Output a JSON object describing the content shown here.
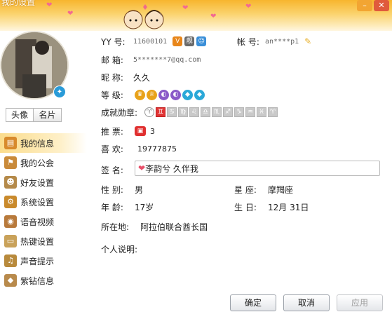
{
  "window": {
    "title": "我的设置"
  },
  "profile": {
    "tabs": [
      "头像",
      "名片"
    ]
  },
  "menu": [
    {
      "label": "我的信息",
      "icon": "id-card-icon",
      "color": "#d88a2c"
    },
    {
      "label": "我的公会",
      "icon": "flag-icon",
      "color": "#c98a3a"
    },
    {
      "label": "好友设置",
      "icon": "friend-gear-icon",
      "color": "#b58a4a"
    },
    {
      "label": "系统设置",
      "icon": "gear-icon",
      "color": "#c98a2c"
    },
    {
      "label": "语音视频",
      "icon": "headset-icon",
      "color": "#b87a3c"
    },
    {
      "label": "热键设置",
      "icon": "keyboard-icon",
      "color": "#c9a25a"
    },
    {
      "label": "声音提示",
      "icon": "music-note-icon",
      "color": "#b88a3c"
    },
    {
      "label": "紫钻信息",
      "icon": "diamond-icon",
      "color": "#b88a4c"
    }
  ],
  "info": {
    "yy_label": "YY  号:",
    "yy_value": "11600101",
    "account_label": "帐  号:",
    "account_value": "an****p1",
    "email_label": "邮  箱:",
    "email_value": "5*******7@qq.com",
    "nickname_label": "昵  称:",
    "nickname_value": "久久",
    "level_label": "等  级:",
    "medal_label": "成就勋章:",
    "vote_label": "推  票:",
    "vote_value": "3",
    "like_label": "喜  欢:",
    "like_value": "19777875",
    "sign_label": "签  名:",
    "sign_value": "李韵兮 久伴我",
    "gender_label": "性  别:",
    "gender_value": "男",
    "star_label": "星  座:",
    "star_value": "摩羯座",
    "age_label": "年  龄:",
    "age_value": "17岁",
    "birthday_label": "生  日:",
    "birthday_value": "12月  31日",
    "location_label": "所在地:",
    "location_value": "阿拉伯联合酋长国",
    "desc_label": "个人说明:"
  },
  "buttons": {
    "ok": "确定",
    "cancel": "取消",
    "apply": "应用"
  }
}
